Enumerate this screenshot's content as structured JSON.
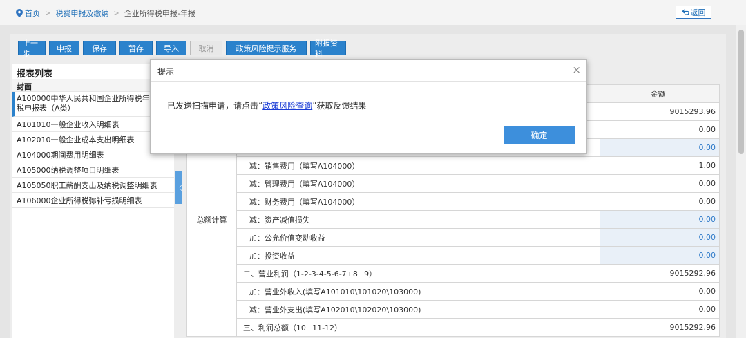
{
  "breadcrumb": {
    "home": "首页",
    "level2": "税费申报及缴纳",
    "current": "企业所得税申报-年报",
    "separator": ">"
  },
  "back_button": "返回",
  "toolbar": {
    "buttons": [
      "上一步",
      "申报",
      "保存",
      "暂存",
      "导入",
      "取消",
      "政策风险提示服务",
      "附报资料"
    ]
  },
  "sidebar": {
    "title": "报表列表",
    "cover": "封面",
    "items": [
      "A100000中华人民共和国企业所得税年度纳税申报表（A类）",
      "A101010一般企业收入明细表",
      "A102010一般企业成本支出明细表",
      "A104000期间费用明细表",
      "A105000纳税调整项目明细表",
      "A105050职工薪酬支出及纳税调整明细表",
      "A106000企业所得税弥补亏损明细表"
    ],
    "collapse_glyph": "〈"
  },
  "table": {
    "amount_header": "金额",
    "category_label": "总额计算",
    "rows": [
      {
        "label": "",
        "amount": "9015293.96",
        "editable": false
      },
      {
        "label": "",
        "amount": "0.00",
        "editable": false
      },
      {
        "label": "",
        "amount": "0.00",
        "editable": true
      },
      {
        "label": "减：销售费用（填写A104000）",
        "amount": "1.00",
        "editable": false
      },
      {
        "label": "减：管理费用（填写A104000）",
        "amount": "0.00",
        "editable": false
      },
      {
        "label": "减：财务费用（填写A104000）",
        "amount": "0.00",
        "editable": false
      },
      {
        "label": "减：资产减值损失",
        "amount": "0.00",
        "editable": true
      },
      {
        "label": "加：公允价值变动收益",
        "amount": "0.00",
        "editable": true
      },
      {
        "label": "加：投资收益",
        "amount": "0.00",
        "editable": true
      },
      {
        "label": "二、营业利润（1-2-3-4-5-6-7+8+9）",
        "amount": "9015292.96",
        "editable": false
      },
      {
        "label": "加：营业外收入(填写A101010\\101020\\103000)",
        "amount": "0.00",
        "editable": false
      },
      {
        "label": "减：营业外支出(填写A102010\\102020\\103000)",
        "amount": "0.00",
        "editable": false
      },
      {
        "label": "三、利润总额（10+11-12）",
        "amount": "9015292.96",
        "editable": false
      }
    ]
  },
  "dialog": {
    "title": "提示",
    "close": "×",
    "message_before": "已发送扫描申请，请点击“",
    "message_link": "政策风险查询",
    "message_after": "”获取反馈结果",
    "ok_label": "确定"
  }
}
